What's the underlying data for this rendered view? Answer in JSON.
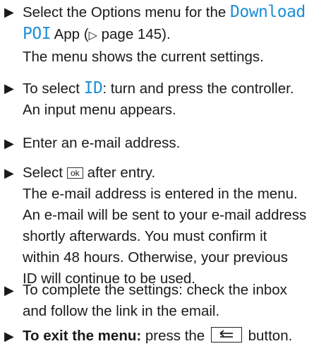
{
  "steps": [
    {
      "l1a": "Select the Options menu for the ",
      "l1b": "Download",
      "l2a": "POI",
      "l2b": " App (",
      "l2c": "▷",
      "l2d": " page 145).",
      "l3": "The menu shows the current settings."
    },
    {
      "l1a": "To select ",
      "l1b": "ID",
      "l1c": ": turn and press the controller.",
      "l2": "An input menu appears."
    },
    {
      "l1": "Enter an e-mail address."
    },
    {
      "l1a": "Select",
      "key": "ok",
      "l1b": "after entry.",
      "l2": "The e-mail address is entered in the menu.",
      "l3": "An e-mail will be sent to your e-mail address",
      "l4": "shortly afterwards. You must confirm it",
      "l5": "within 48 hours. Otherwise, your previous",
      "l6": "ID will continue to be used."
    },
    {
      "l1": "To complete the settings: check the inbox",
      "l2": "and follow the link in the email."
    },
    {
      "l1a": "To exit the menu:",
      "l1b": " press the ",
      "key_icon": "back-button-icon",
      "l1c": " button."
    }
  ],
  "bullet": "▶"
}
